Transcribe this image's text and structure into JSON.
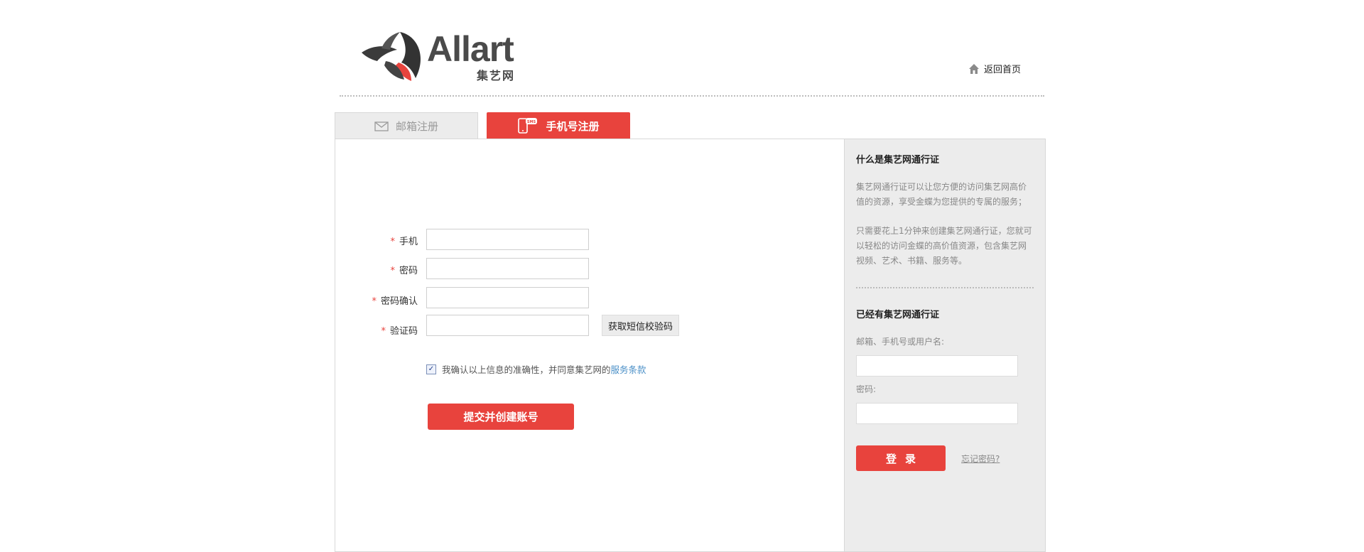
{
  "brand": {
    "name": "Allart",
    "subtitle": "集艺网",
    "accent_color": "#e8433d"
  },
  "header": {
    "home_link_label": "返回首页",
    "home_icon": "home-icon"
  },
  "tabs": [
    {
      "label": "邮箱注册",
      "icon": "envelope-icon",
      "active": false
    },
    {
      "label": "手机号注册",
      "icon": "phone-sms-icon",
      "active": true
    }
  ],
  "form": {
    "required_mark": "*",
    "phone_label": "手机",
    "password_label": "密码",
    "confirm_label": "密码确认",
    "code_label": "验证码",
    "phone_value": "",
    "password_value": "",
    "confirm_value": "",
    "code_value": "",
    "sms_button": "获取短信校验码",
    "agree_checked": true,
    "agree_text": "我确认以上信息的准确性，并同意集艺网的",
    "terms_link": "服务条款",
    "submit_label": "提交并创建账号"
  },
  "sidebar": {
    "what_title": "什么是集艺网通行证",
    "para1": "集艺网通行证可以让您方便的访问集艺网高价值的资源，享受金蝶为您提供的专属的服务；",
    "para2": "只需要花上1分钟来创建集艺网通行证，您就可以轻松的访问金蝶的高价值资源，包含集艺网视频、艺术、书籍、服务等。",
    "have_title": "已经有集艺网通行证",
    "account_label": "邮箱、手机号或用户名:",
    "account_value": "",
    "password_label": "密码:",
    "password_value": "",
    "login_button": "登录",
    "forgot_link": "忘记密码?"
  }
}
